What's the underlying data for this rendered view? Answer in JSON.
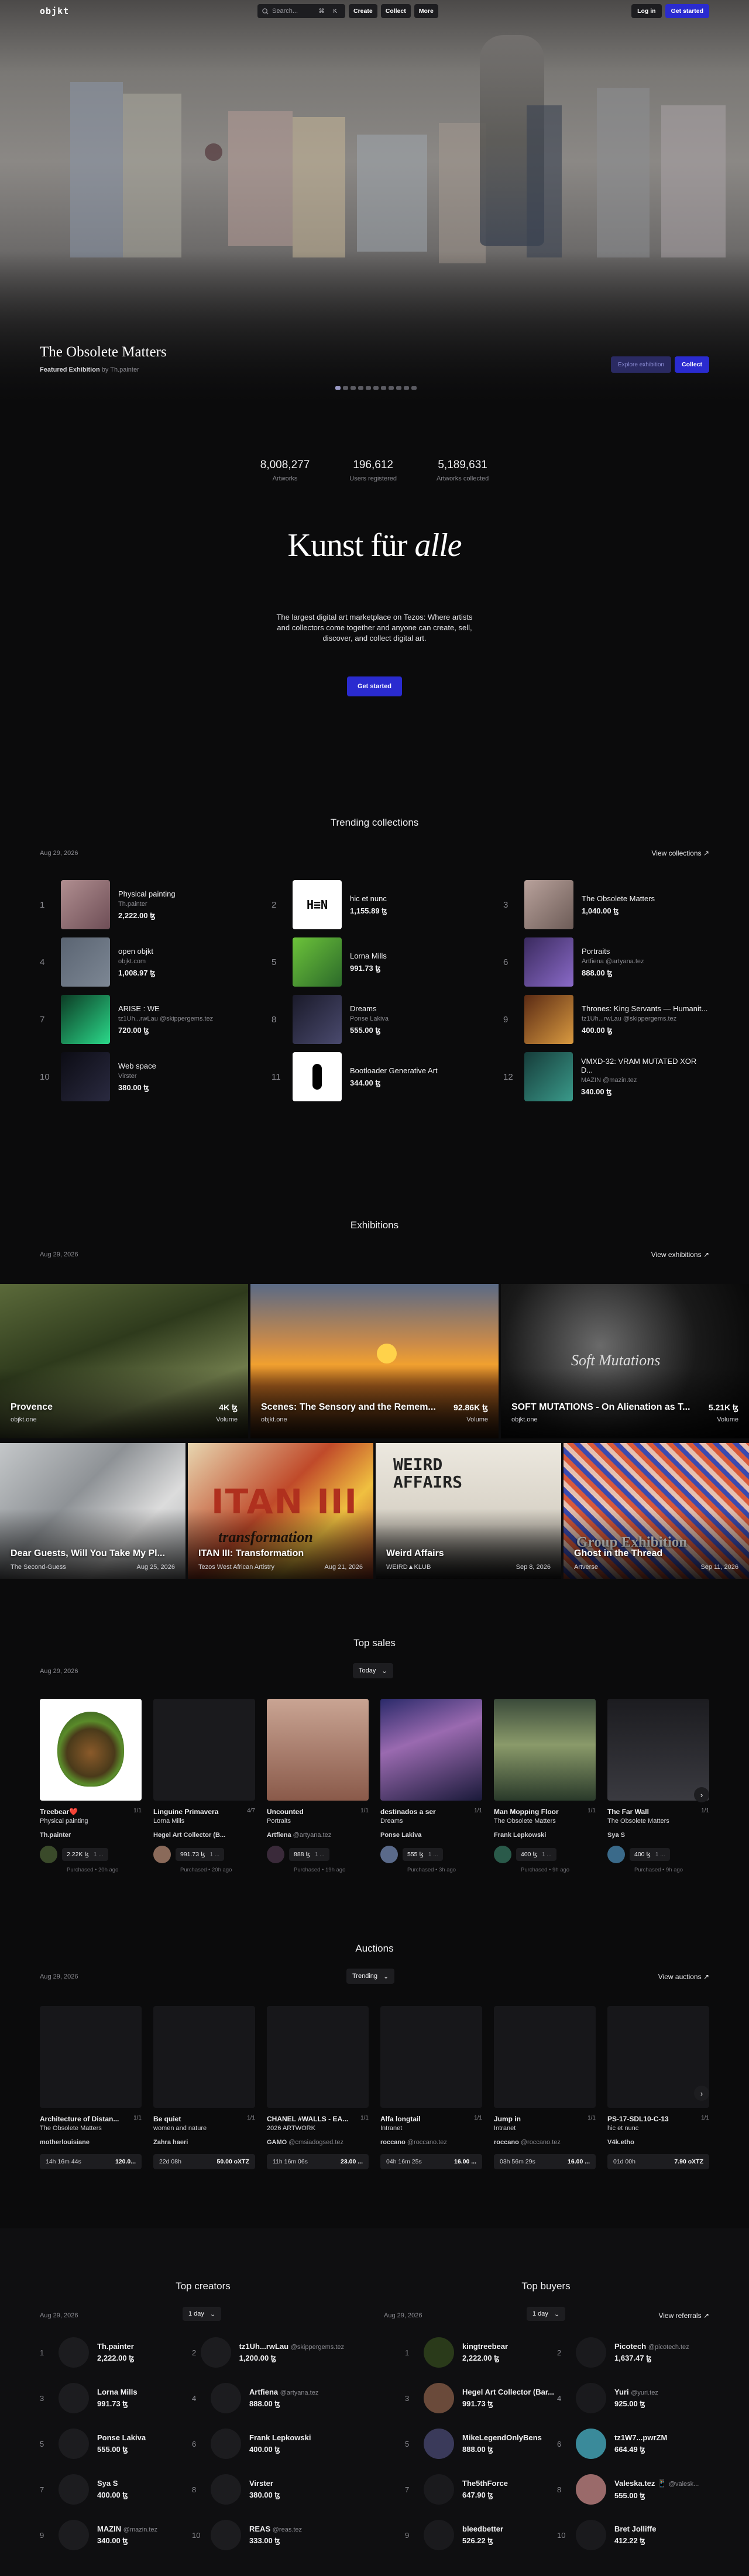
{
  "nav": {
    "logo": "objkt",
    "search_placeholder": "Search...",
    "search_kbd": "⌘ K",
    "create": "Create",
    "collect": "Collect",
    "more": "More",
    "login": "Log in",
    "get_started": "Get started"
  },
  "hero": {
    "title": "The Obsolete Matters",
    "featured": "Featured Exhibition",
    "featured_by": "by Th.painter",
    "explore": "Explore exhibition",
    "collect": "Collect",
    "slides": 11,
    "active_slide": 0
  },
  "stats": [
    {
      "value": "8,008,277",
      "label": "Artworks"
    },
    {
      "value": "196,612",
      "label": "Users registered"
    },
    {
      "value": "5,189,631",
      "label": "Artworks collected"
    }
  ],
  "intro": {
    "title_a": "Kunst für ",
    "title_b": "alle",
    "lead": "The largest digital art marketplace on Tezos: Where artists and collectors come together and anyone can create, sell, discover, and collect digital art.",
    "cta": "Get started"
  },
  "trending": {
    "title": "Trending collections",
    "date": "Aug 29, 2026",
    "link": "View collections",
    "items": [
      {
        "n": "1",
        "name": "Physical painting",
        "sub": "Th.painter",
        "value": "2,222.00 ꜩ",
        "c1": "#b08e90",
        "c2": "#6e4e56"
      },
      {
        "n": "2",
        "name": "hic et nunc",
        "sub": "",
        "value": "1,155.89 ꜩ",
        "c1": "#ffffff",
        "c2": "#ffffff"
      },
      {
        "n": "3",
        "name": "The Obsolete Matters",
        "sub": "",
        "value": "1,040.00 ꜩ",
        "c1": "#b8a19b",
        "c2": "#6d5c57"
      },
      {
        "n": "4",
        "name": "open objkt",
        "sub": "objkt.com",
        "value": "1,008.97 ꜩ",
        "c1": "#5a6472",
        "c2": "#7d8794"
      },
      {
        "n": "5",
        "name": "Lorna Mills",
        "sub": "",
        "value": "991.73 ꜩ",
        "c1": "#6cc33a",
        "c2": "#2c6a2a"
      },
      {
        "n": "6",
        "name": "Portraits",
        "sub": "Artfiena @artyana.tez",
        "value": "888.00 ꜩ",
        "c1": "#3a2a5e",
        "c2": "#8a6ac8"
      },
      {
        "n": "7",
        "name": "ARISE : WE",
        "sub": "tz1Uh...rwLau @skippergems.tez",
        "value": "720.00 ꜩ",
        "c1": "#0c3b24",
        "c2": "#2bd98a"
      },
      {
        "n": "8",
        "name": "Dreams",
        "sub": "Ponse Lakiva",
        "value": "555.00 ꜩ",
        "c1": "#1a1a2a",
        "c2": "#4a4a6e"
      },
      {
        "n": "9",
        "name": "Thrones: King Servants — Humanit...",
        "sub": "tz1Uh...rwLau @skippergems.tez",
        "value": "400.00 ꜩ",
        "c1": "#5a2a14",
        "c2": "#d99a40"
      },
      {
        "n": "10",
        "name": "Web space",
        "sub": "Virster",
        "value": "380.00 ꜩ",
        "c1": "#0c0c14",
        "c2": "#2a2a40"
      },
      {
        "n": "11",
        "name": "Bootloader Generative Art",
        "sub": "",
        "value": "344.00 ꜩ",
        "c1": "#ffffff",
        "c2": "#ffffff"
      },
      {
        "n": "12",
        "name": "VMXD-32: VRAM MUTATED XOR D...",
        "sub": "MAZIN @mazin.tez",
        "value": "340.00 ꜩ",
        "c1": "#163c3a",
        "c2": "#3a9a8a"
      }
    ]
  },
  "exhibitions": {
    "title": "Exhibitions",
    "date": "Aug 29, 2026",
    "link": "View exhibitions",
    "row1": [
      {
        "title": "Provence",
        "sub": "objkt.one",
        "volume": "4K ꜩ",
        "volume_label": "Volume"
      },
      {
        "title": "Scenes: The Sensory and the Remem...",
        "sub": "objkt.one",
        "volume": "92.86K ꜩ",
        "volume_label": "Volume"
      },
      {
        "title": "SOFT MUTATIONS - On Alienation as T...",
        "sub": "objkt.one",
        "volume": "5.21K ꜩ",
        "volume_label": "Volume",
        "overlay": "Soft Mutations"
      }
    ],
    "row2": [
      {
        "title": "Dear Guests, Will You Take My Pl...",
        "sub": "The Second-Guess",
        "date": "Aug 25, 2026"
      },
      {
        "title": "ITAN III: Transformation",
        "sub": "Tezos West African Artistry",
        "date": "Aug 21, 2026",
        "overlay": "ITAN III",
        "overlay2": "transformation"
      },
      {
        "title": "Weird Affairs",
        "sub": "WEIRD▲KLUB",
        "date": "Sep 8, 2026",
        "overlay": "WEIRD AFFAIRS"
      },
      {
        "title": "Ghost in the Thread",
        "sub": "Artverse",
        "date": "Sep 11, 2026",
        "overlay": "Group Exhibition"
      }
    ]
  },
  "top_sales": {
    "title": "Top sales",
    "date": "Aug 29, 2026",
    "filter": "Today",
    "items": [
      {
        "title": "Treebear❤️",
        "ed": "1/1",
        "coll": "Physical painting",
        "artist": "Th.painter",
        "handle": "",
        "price": "2.22K ꜩ",
        "pt": "1 ...",
        "when": "Purchased • 20h ago",
        "av": "#3a4a2a"
      },
      {
        "title": "Linguine Primavera",
        "ed": "4/7",
        "coll": "Lorna Mills",
        "artist": "Hegel Art Collector (B...",
        "handle": "",
        "price": "991.73 ꜩ",
        "pt": "1 ...",
        "when": "Purchased • 20h ago",
        "av": "#8a6a5a"
      },
      {
        "title": "Uncounted",
        "ed": "1/1",
        "coll": "Portraits",
        "artist": "Artfiena",
        "handle": "@artyana.tez",
        "price": "888 ꜩ",
        "pt": "1 ...",
        "when": "Purchased • 19h ago",
        "av": "#3a2a3a"
      },
      {
        "title": "destinados a ser",
        "ed": "1/1",
        "coll": "Dreams",
        "artist": "Ponse Lakiva",
        "handle": "",
        "price": "555 ꜩ",
        "pt": "1 ...",
        "when": "Purchased • 3h ago",
        "av": "#5a6a8a"
      },
      {
        "title": "Man Mopping Floor",
        "ed": "1/1",
        "coll": "The Obsolete Matters",
        "artist": "Frank Lepkowski",
        "handle": "",
        "price": "400 ꜩ",
        "pt": "1 ...",
        "when": "Purchased • 9h ago",
        "av": "#2a5a4a"
      },
      {
        "title": "The Far Wall",
        "ed": "1/1",
        "coll": "The Obsolete Matters",
        "artist": "Sya S",
        "handle": "",
        "price": "400 ꜩ",
        "pt": "1 ...",
        "when": "Purchased • 9h ago",
        "av": "#3a6a8a"
      }
    ]
  },
  "auctions": {
    "title": "Auctions",
    "date": "Aug 29, 2026",
    "filter": "Trending",
    "link": "View auctions",
    "items": [
      {
        "title": "Architecture of Distan...",
        "ed": "1/1",
        "coll": "The Obsolete Matters",
        "artist": "motherlouisiane",
        "timer": "14h 16m 44s",
        "price": "120.0..."
      },
      {
        "title": "Be quiet",
        "ed": "1/1",
        "coll": "women and nature",
        "artist": "Zahra haeri",
        "timer": "22d 08h",
        "price": "50.00 oXTZ"
      },
      {
        "title": "CHANEL #WALLS - EA...",
        "ed": "1/1",
        "coll": "2026 ARTWORK",
        "artist": "GAMO",
        "handle": "@cmsiadogsed.tez",
        "timer": "11h 16m 06s",
        "price": "23.00 ..."
      },
      {
        "title": "Alfa longtail",
        "ed": "1/1",
        "coll": "Intranet",
        "artist": "roccano",
        "handle": "@roccano.tez",
        "timer": "04h 16m 25s",
        "price": "16.00 ..."
      },
      {
        "title": "Jump in",
        "ed": "1/1",
        "coll": "Intranet",
        "artist": "roccano",
        "handle": "@roccano.tez",
        "timer": "03h 56m 29s",
        "price": "16.00 ..."
      },
      {
        "title": "PS-17-SDL10-C-13",
        "ed": "1/1",
        "coll": "hic et nunc",
        "artist": "V4k.etho",
        "timer": "01d 00h",
        "price": "7.90 oXTZ"
      }
    ]
  },
  "top_creators": {
    "title": "Top creators",
    "date": "Aug 29, 2026",
    "filter": "1 day",
    "items": [
      {
        "n": "1",
        "name": "Th.painter",
        "handle": "",
        "value": "2,222.00 ꜩ"
      },
      {
        "n": "2",
        "name": "tz1Uh...rwLau",
        "handle": "@skippergems.tez",
        "value": "1,200.00 ꜩ"
      },
      {
        "n": "3",
        "name": "Lorna Mills",
        "handle": "",
        "value": "991.73 ꜩ"
      },
      {
        "n": "4",
        "name": "Artfiena",
        "handle": "@artyana.tez",
        "value": "888.00 ꜩ"
      },
      {
        "n": "5",
        "name": "Ponse Lakiva",
        "handle": "",
        "value": "555.00 ꜩ"
      },
      {
        "n": "6",
        "name": "Frank Lepkowski",
        "handle": "",
        "value": "400.00 ꜩ"
      },
      {
        "n": "7",
        "name": "Sya S",
        "handle": "",
        "value": "400.00 ꜩ"
      },
      {
        "n": "8",
        "name": "Virster",
        "handle": "",
        "value": "380.00 ꜩ"
      },
      {
        "n": "9",
        "name": "MAZIN",
        "handle": "@mazin.tez",
        "value": "340.00 ꜩ"
      },
      {
        "n": "10",
        "name": "REAS",
        "handle": "@reas.tez",
        "value": "333.00 ꜩ"
      }
    ]
  },
  "top_buyers": {
    "title": "Top buyers",
    "date": "Aug 29, 2026",
    "filter": "1 day",
    "link": "View referrals",
    "items": [
      {
        "n": "1",
        "name": "kingtreebear",
        "handle": "",
        "value": "2,222.00 ꜩ"
      },
      {
        "n": "2",
        "name": "Picotech",
        "handle": "@picotech.tez",
        "value": "1,637.47 ꜩ"
      },
      {
        "n": "3",
        "name": "Hegel Art Collector (Bar...",
        "handle": "",
        "value": "991.73 ꜩ"
      },
      {
        "n": "4",
        "name": "Yuri‍",
        "handle": "@yuri‍.tez",
        "value": "925.00 ꜩ"
      },
      {
        "n": "5",
        "name": "MikeLegendOnlyBens",
        "handle": "",
        "value": "888.00 ꜩ"
      },
      {
        "n": "6",
        "name": "tz1W7...pwrZM",
        "handle": "",
        "value": "664.49 ꜩ"
      },
      {
        "n": "7",
        "name": "The5thForce",
        "handle": "",
        "value": "647.90 ꜩ"
      },
      {
        "n": "8",
        "name": "Valeska.tez 📱",
        "handle": "@valesk...",
        "value": "555.00 ꜩ"
      },
      {
        "n": "9",
        "name": "bleedbetter",
        "handle": "",
        "value": "526.22 ꜩ"
      },
      {
        "n": "10",
        "name": "Bret Jolliffe",
        "handle": "",
        "value": "412.22 ꜩ"
      }
    ]
  }
}
